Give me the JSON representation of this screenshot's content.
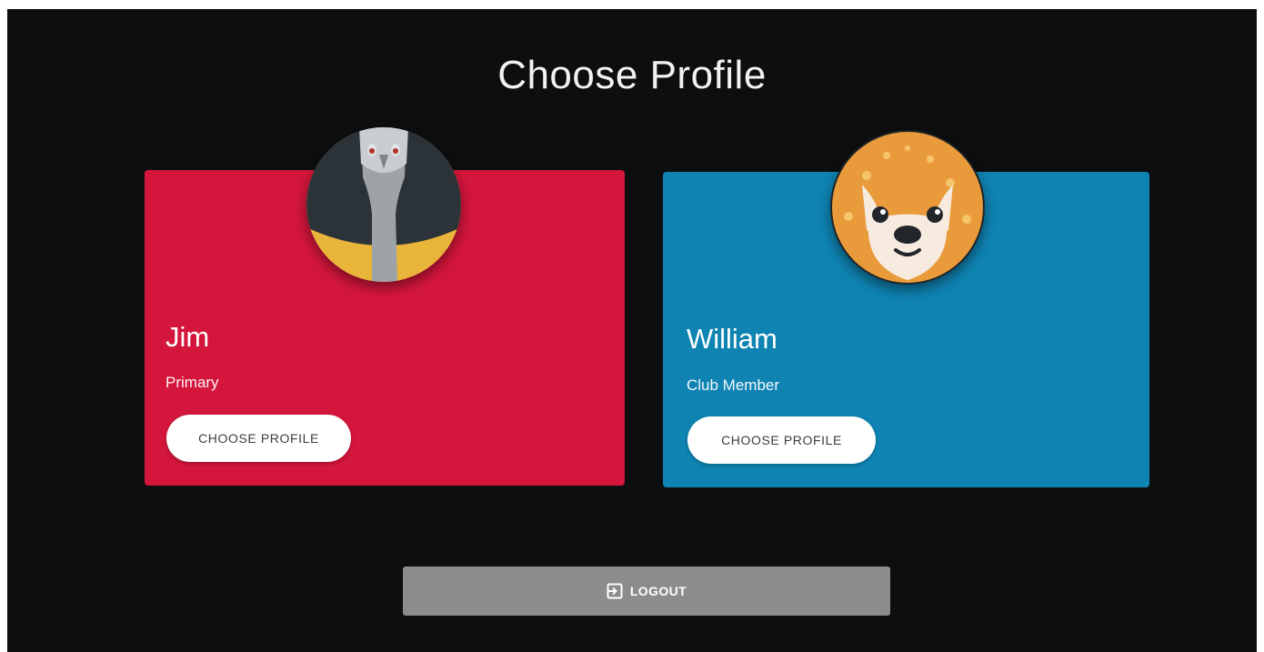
{
  "page": {
    "title": "Choose Profile"
  },
  "profiles": [
    {
      "name": "Jim",
      "role": "Primary",
      "button_label": "CHOOSE PROFILE",
      "card_color": "#d4163c",
      "avatar_icon": "bird-icon"
    },
    {
      "name": "William",
      "role": "Club Member",
      "button_label": "CHOOSE PROFILE",
      "card_color": "#0f84b3",
      "avatar_icon": "fawn-icon"
    }
  ],
  "logout": {
    "label": "LOGOUT",
    "icon": "logout-icon"
  },
  "colors": {
    "background": "#0d0e0f",
    "logout_button": "#8c8c8c"
  }
}
